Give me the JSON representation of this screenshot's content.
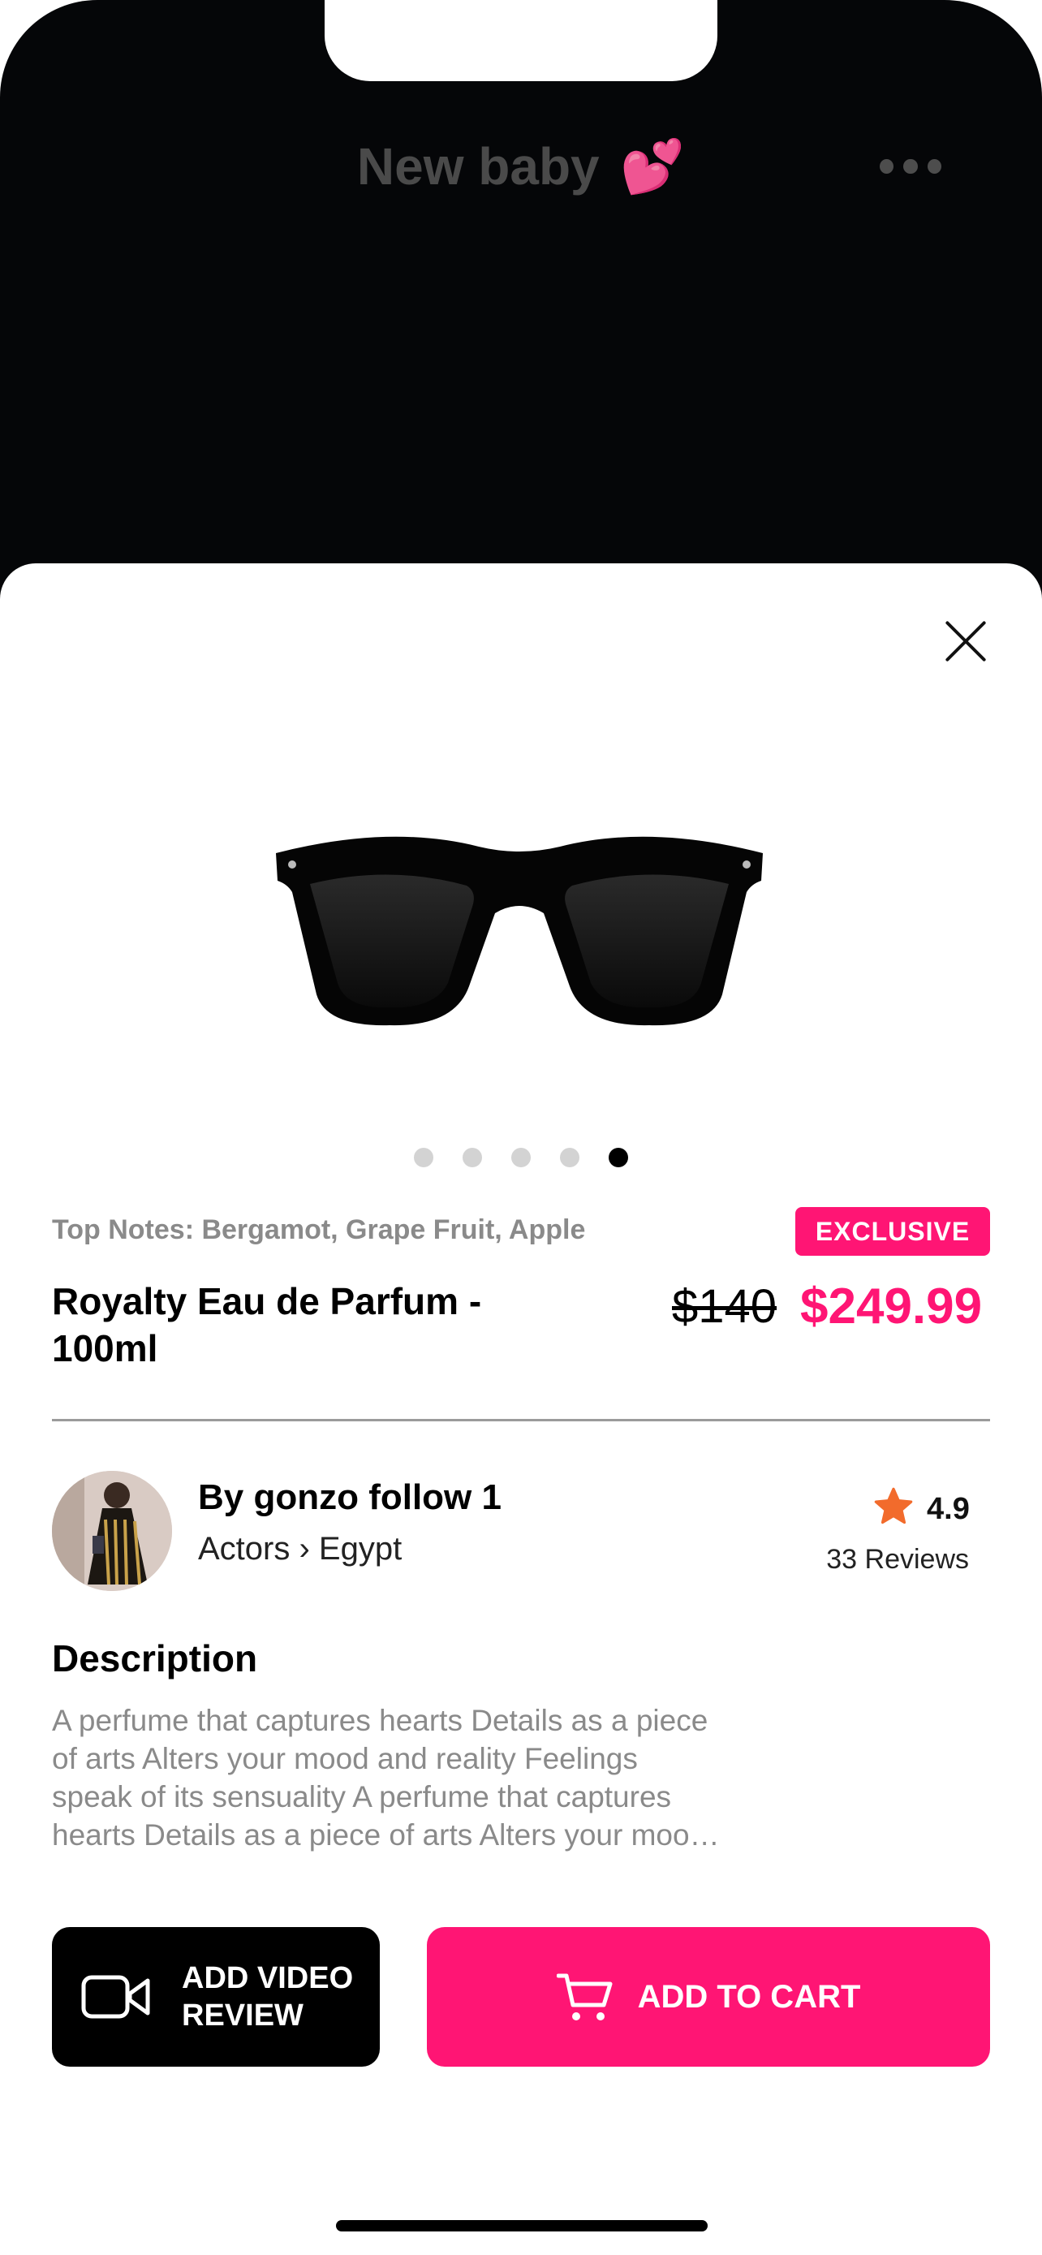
{
  "background_screen": {
    "title": "New baby",
    "title_emoji": "💕"
  },
  "product": {
    "top_notes": "Top Notes: Bergamot, Grape Fruit, Apple",
    "badge": "EXCLUSIVE",
    "title": "Royalty Eau de Parfum - 100ml",
    "old_price": "$140",
    "price": "$249.99",
    "image_count": 5,
    "active_image_index": 4
  },
  "seller": {
    "name": "By gonzo follow 1",
    "category": "Actors › Egypt",
    "rating": "4.9",
    "reviews": "33 Reviews"
  },
  "description": {
    "heading": "Description",
    "text": "A perfume that captures hearts Details as a piece of arts Alters your mood and reality Feelings speak of its sensuality A perfume that captures hearts Details as a piece of arts Alters your mood and reality"
  },
  "actions": {
    "video_review_label": "ADD VIDEO REVIEW",
    "add_to_cart_label": "ADD TO CART"
  },
  "colors": {
    "accent": "#ff1574",
    "star": "#f26b2c",
    "background_screen": "#050608"
  }
}
